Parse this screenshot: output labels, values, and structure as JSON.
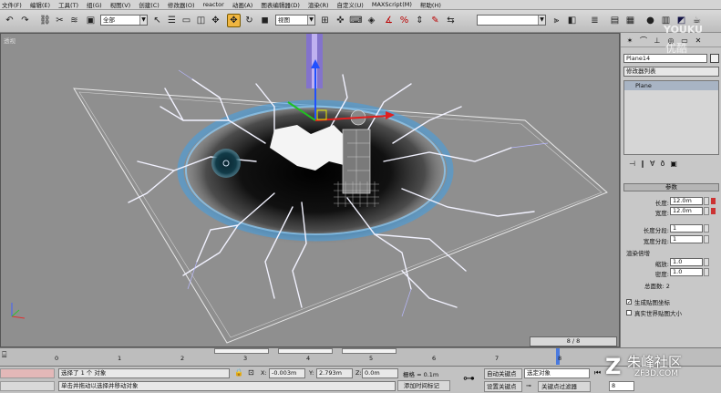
{
  "menubar": [
    "文件(F)",
    "编辑(E)",
    "工具(T)",
    "组(G)",
    "视图(V)",
    "创建(C)",
    "修改器(O)",
    "reactor",
    "动画(A)",
    "图表编辑器(D)",
    "渲染(R)",
    "自定义(U)",
    "MAXScript(M)",
    "帮助(H)"
  ],
  "toolbar": {
    "selection_filter": "全部",
    "ref_coord": "视图",
    "named_sel": ""
  },
  "viewport": {
    "label": "透视"
  },
  "command_panel": {
    "object_name": "Plane14",
    "modifier_list": "修改器列表",
    "stack_item": "Plane",
    "rollout_title": "参数",
    "length_label": "长度:",
    "length_value": "12.0m",
    "width_label": "宽度:",
    "width_value": "12.0m",
    "length_segs_label": "长度分段:",
    "length_segs_value": "1",
    "width_segs_label": "宽度分段:",
    "width_segs_value": "1",
    "render_mult_title": "渲染倍增",
    "scale_label": "缩放:",
    "scale_value": "1.0",
    "density_label": "密度:",
    "density_value": "1.0",
    "total_faces": "总面数: 2",
    "gen_map_coords": "生成贴图坐标",
    "real_world_map": "真实世界贴图大小"
  },
  "timeline": {
    "frame_display": "8 / 8",
    "ruler": [
      "0",
      "1",
      "2",
      "3",
      "4",
      "5",
      "6",
      "7",
      "8"
    ]
  },
  "status": {
    "selected": "选择了 1 个 对象",
    "prompt": "单击并拖动以选择并移动对象",
    "x_label": "X:",
    "x_value": "-0.003m",
    "y_label": "Y:",
    "y_value": "2.793m",
    "z_label": "Z:",
    "z_value": "0.0m",
    "grid": "栅格 = 0.1m",
    "add_time_tag": "添加时间标记",
    "auto_key": "自动关键点",
    "set_key": "设置关键点",
    "selected_obj": "选定对象",
    "key_filters": "关键点过滤器",
    "frame_field": "8"
  },
  "watermark": {
    "brand": "朱峰社区",
    "url": "ZF3D.COM",
    "youku": "YOUKU",
    "youku_cn": "优酷"
  },
  "colors": {
    "viewport_bg": "#8f8f8f",
    "ring": "#3fa0e8",
    "active_tool": "#f0b640"
  }
}
